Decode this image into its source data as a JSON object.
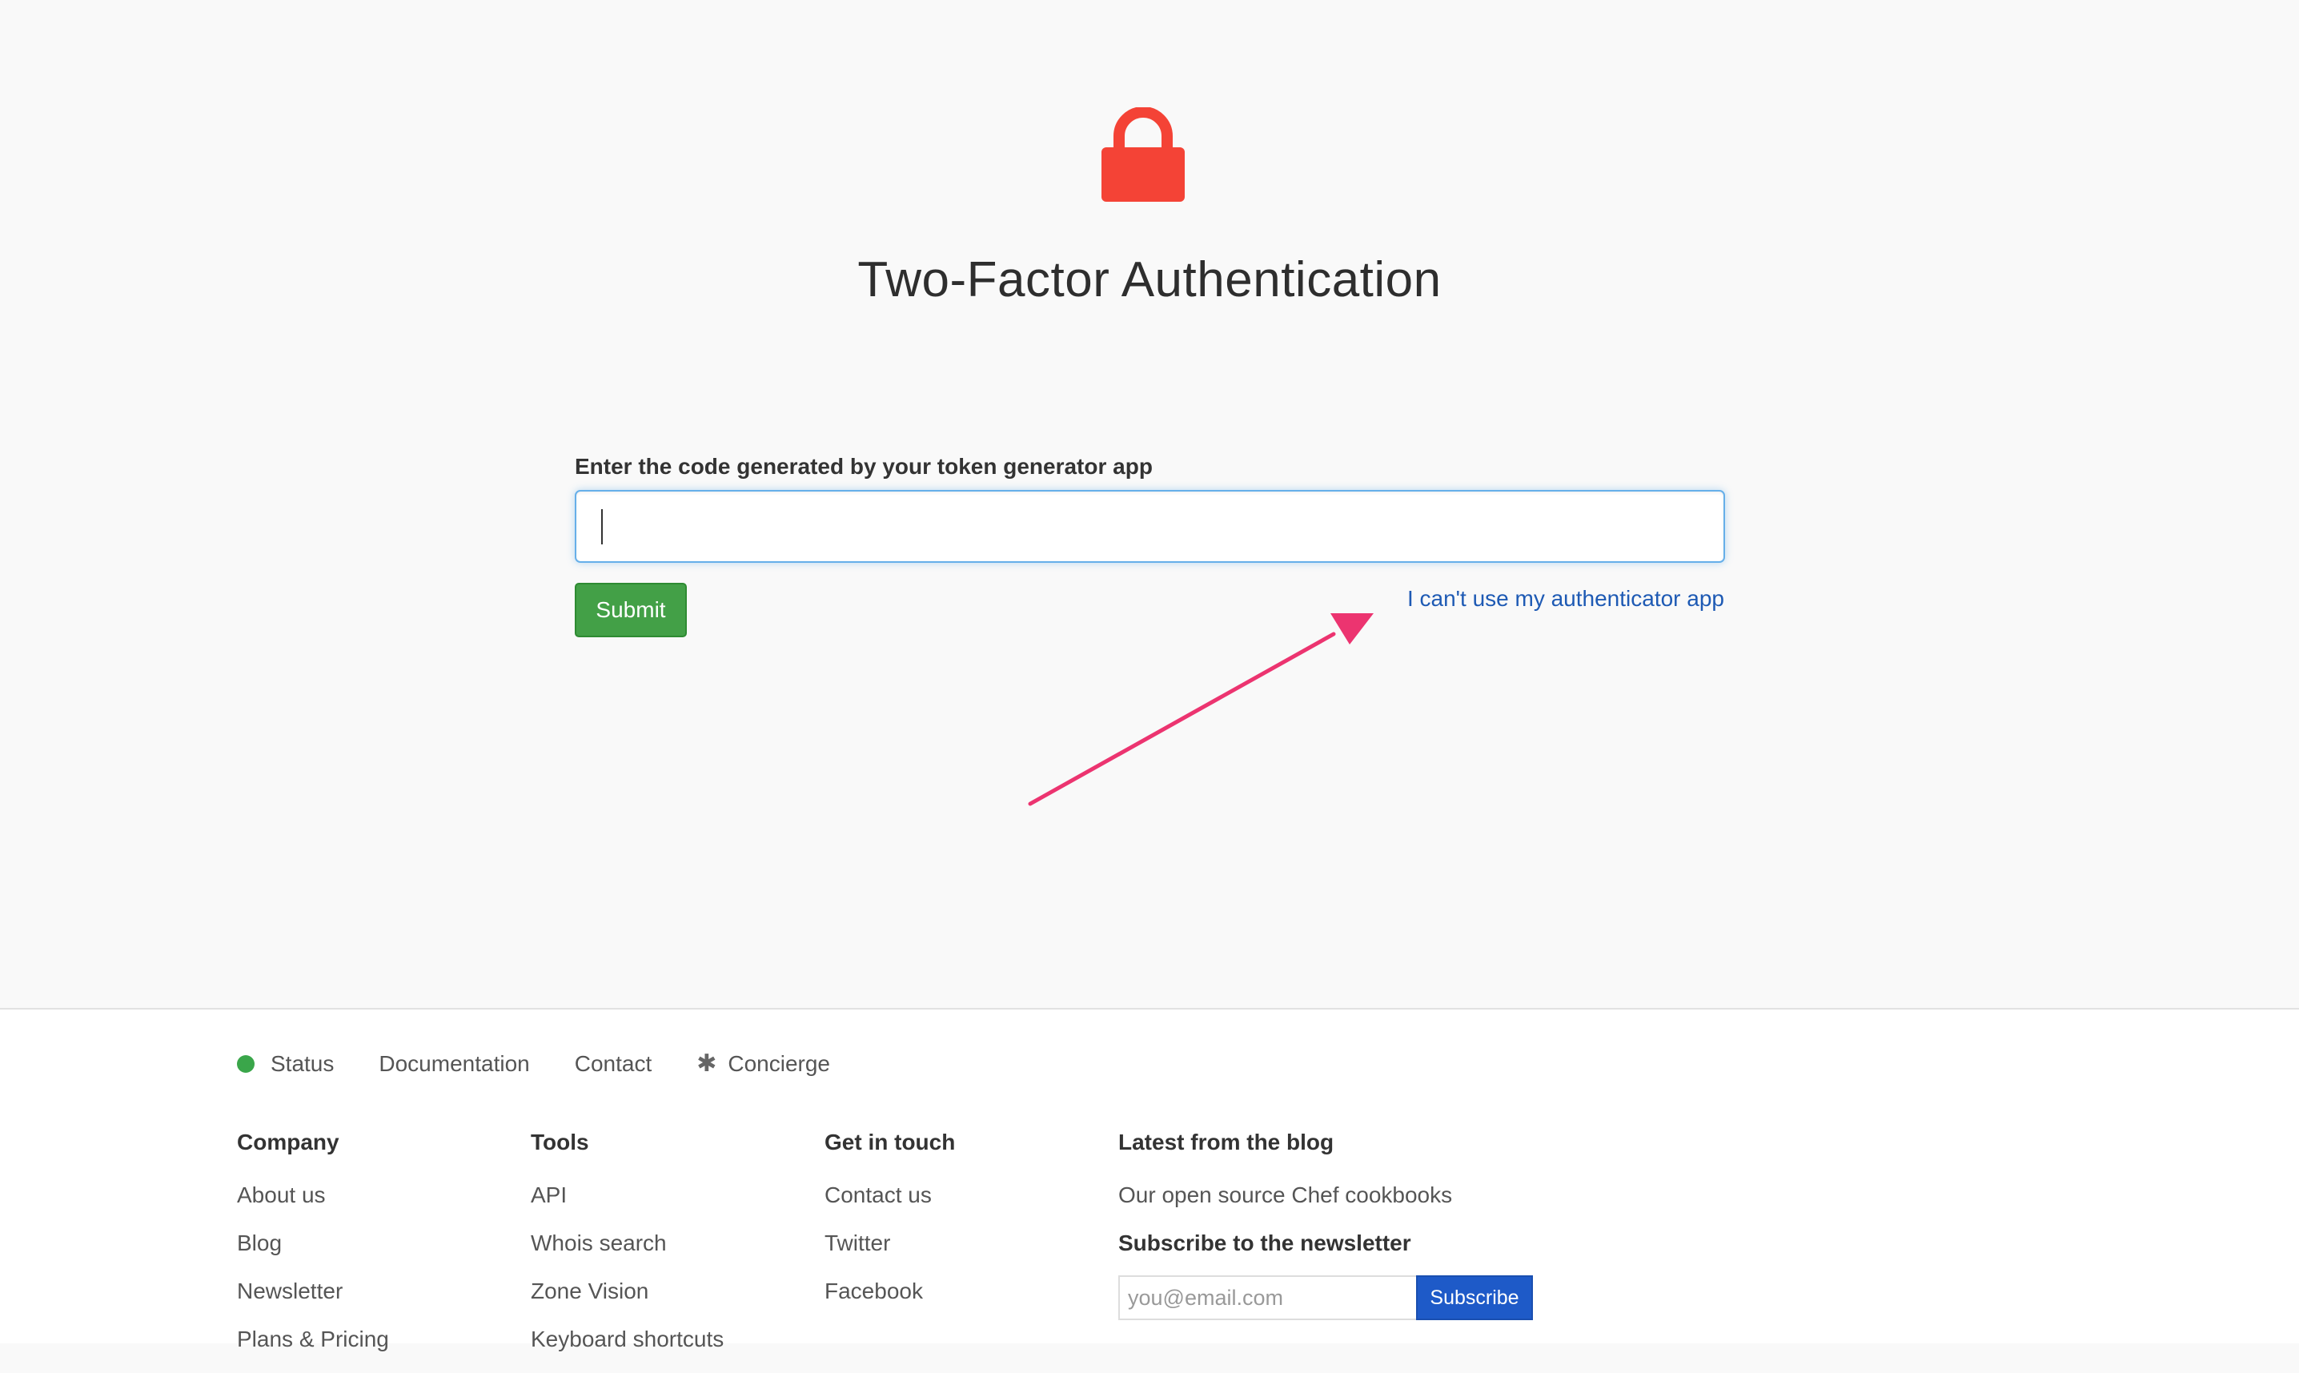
{
  "auth": {
    "title": "Two-Factor Authentication",
    "field_label": "Enter the code generated by your token generator app",
    "code_value": "",
    "submit_label": "Submit",
    "alt_link": "I can't use my authenticator app",
    "lock_icon": "lock-icon",
    "lock_color": "#f44336"
  },
  "colors": {
    "submit": "#43a047",
    "link": "#1e5ab4",
    "annotation_arrow": "#ec3470",
    "status_ok": "#3aa64a",
    "subscribe": "#1e5ac8"
  },
  "footer": {
    "links": {
      "status": "Status",
      "documentation": "Documentation",
      "contact": "Contact",
      "concierge": "Concierge"
    },
    "company": {
      "heading": "Company",
      "items": [
        "About us",
        "Blog",
        "Newsletter",
        "Plans & Pricing"
      ]
    },
    "tools": {
      "heading": "Tools",
      "items": [
        "API",
        "Whois search",
        "Zone Vision",
        "Keyboard shortcuts"
      ]
    },
    "touch": {
      "heading": "Get in touch",
      "items": [
        "Contact us",
        "Twitter",
        "Facebook"
      ]
    },
    "blog": {
      "heading": "Latest from the blog",
      "post": "Our open source Chef cookbooks",
      "newsletter_heading": "Subscribe to the newsletter",
      "email_placeholder": "you@email.com",
      "subscribe_label": "Subscribe"
    }
  }
}
